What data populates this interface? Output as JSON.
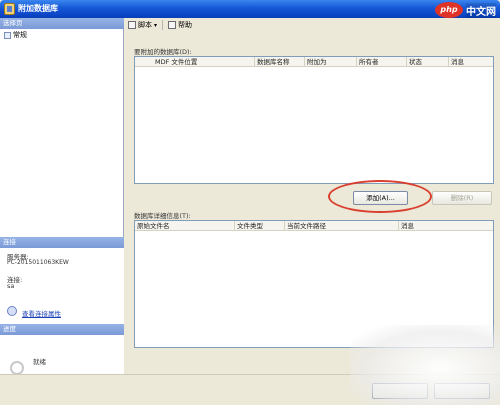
{
  "window": {
    "title": "附加数据库"
  },
  "left_panel": {
    "select_page_header": "选择页",
    "nav_items": [
      {
        "label": "常规"
      }
    ],
    "connection_header": "连接",
    "server_label": "服务器:",
    "server_value": "PC-2015011063KEW",
    "conn_label": "连接:",
    "conn_value": "sa",
    "view_conn_props_link": "查看连接属性",
    "progress_header": "进度",
    "progress_status": "就绪"
  },
  "toolbar": {
    "script_label": "脚本",
    "help_label": "帮助"
  },
  "attach_section": {
    "label": "要附加的数据库(D):",
    "columns": [
      "MDF 文件位置",
      "数据库名称",
      "附加为",
      "所有者",
      "状态",
      "消息"
    ],
    "rows": []
  },
  "buttons": {
    "add_label": "添加(A)...",
    "remove_label": "删除(R)"
  },
  "details_section": {
    "label": "数据库详细信息(T):",
    "columns": [
      "原始文件名",
      "文件类型",
      "当前文件路径",
      "消息"
    ],
    "rows": []
  },
  "watermark": {
    "logo": "php",
    "text": "中文网"
  },
  "colors": {
    "title_bar": "#1657d6",
    "highlight": "#d94030",
    "link": "#1a3fb8",
    "chrome": "#ece9d8"
  }
}
